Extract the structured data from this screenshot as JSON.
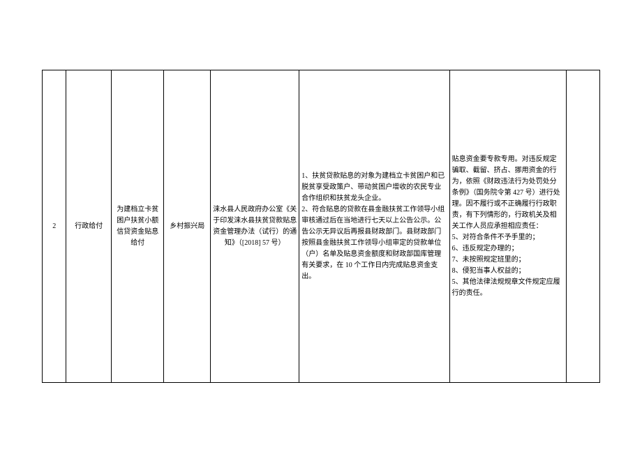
{
  "table": {
    "row": {
      "index": "2",
      "col2": "行政给付",
      "col3": "为建档立卡贫困户扶贫小额信贷资金贴息给付",
      "col4": "乡村振兴局",
      "col5": "涞水县人民政府办公室《关于印发涞水县扶贫贷款贴息资金管理办法（试行）的通知》（[2018] 57 号）",
      "col6": "1、扶贫贷款贴息的对象为建档立卡贫困户和已脱贫享受政策户、带动贫困户增收的农民专业合作组织和扶贫龙头企业。\n2、符合贴息的贷款在县金融扶贫工作领导小组审核通过后在当地进行七天以上公告公示。公告公示无异议后再报县财政部门。县财政部门按照县金融扶贫工作领导小组审定的贷款单位（户）名单及贴息资金额度和财政部国库管理有关要求，在 10 个工作日内完成贴息资金支出。",
      "col7": "贴息资金要专款专用。对违反规定骗取、截留、挤占、挪用资金的行为，依照《财政违法行为处罚处分条例》（国务院令第 427 号）进行处理。因不履行或不正确履行行政职责，有下列情形的，行政机关及相关工作人员应承担相应责任：\n5、对符合条件不予手里的；\n6、违反规定办理的；\n7、未按照规定班里的；\n8、侵犯当事人权益的；\n5、其他法律法规规章文件规定应履行的责任。",
      "col8": ""
    }
  }
}
